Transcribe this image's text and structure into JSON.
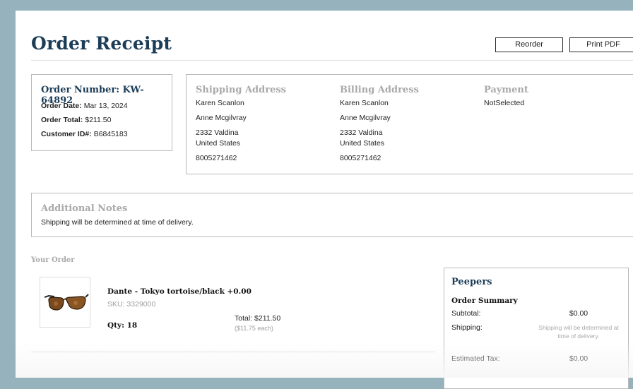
{
  "header": {
    "title": "Order Receipt",
    "reorder_label": "Reorder",
    "print_label": "Print PDF"
  },
  "order": {
    "number_text": "Order Number: KW-64892",
    "date_label": "Order Date:",
    "date_value": "Mar 13, 2024",
    "total_label": "Order Total:",
    "total_value": "$211.50",
    "customer_label": "Customer ID#:",
    "customer_value": "B6845183"
  },
  "shipping": {
    "heading": "Shipping Address",
    "first": "Karen Scanlon",
    "name2": "Anne Mcgilvray",
    "street": "2332 Valdina",
    "country": "United States",
    "phone": "8005271462"
  },
  "billing": {
    "heading": "Billing Address",
    "first": "Karen Scanlon",
    "name2": "Anne Mcgilvray",
    "street": "2332 Valdina",
    "country": "United States",
    "phone": "8005271462"
  },
  "payment": {
    "heading": "Payment",
    "value": "NotSelected"
  },
  "notes": {
    "heading": "Additional Notes",
    "text": "Shipping will be determined at time of delivery."
  },
  "your_order": {
    "label": "Your Order",
    "item": {
      "name": "Dante - Tokyo tortoise/black +0.00",
      "sku": "SKU: 3329000",
      "qty": "Qty: 18",
      "total": "Total: $211.50",
      "each": "($11.75 each)"
    }
  },
  "summary": {
    "brand": "Peepers",
    "heading": "Order Summary",
    "subtotal_label": "Subtotal:",
    "subtotal_value": "$0.00",
    "shipping_label": "Shipping:",
    "shipping_note": "Shipping will be determined at time of delivery.",
    "tax_label": "Estimated Tax:",
    "tax_value": "$0.00"
  },
  "colors": {
    "background": "#96b2bd",
    "brand_navy": "#1c3d57",
    "muted_heading": "#a9a9a9"
  },
  "icons": {
    "product": "eyeglasses-thumbnail"
  }
}
